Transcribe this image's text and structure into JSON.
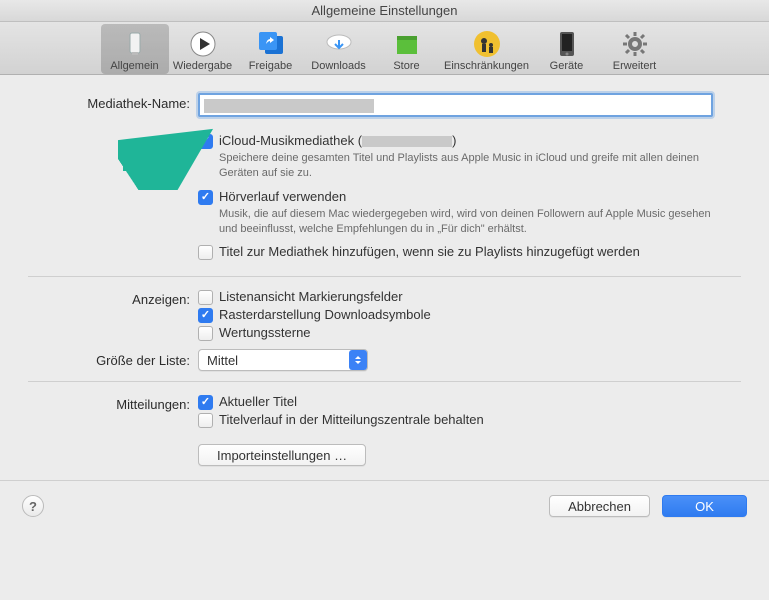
{
  "window": {
    "title": "Allgemeine Einstellungen"
  },
  "toolbar": {
    "items": [
      {
        "label": "Allgemein"
      },
      {
        "label": "Wiedergabe"
      },
      {
        "label": "Freigabe"
      },
      {
        "label": "Downloads"
      },
      {
        "label": "Store"
      },
      {
        "label": "Einschränkungen"
      },
      {
        "label": "Geräte"
      },
      {
        "label": "Erweitert"
      }
    ]
  },
  "labels": {
    "libraryName": "Mediathek-Name:",
    "show": "Anzeigen:",
    "listSize": "Größe der Liste:",
    "notifications": "Mitteilungen:"
  },
  "icloud": {
    "labelPrefix": "iCloud-Musikmediathek (",
    "labelSuffix": ")",
    "desc": "Speichere deine gesamten Titel und Playlists aus Apple Music in iCloud und greife mit allen deinen Geräten auf sie zu."
  },
  "history": {
    "label": "Hörverlauf verwenden",
    "desc": "Musik, die auf diesem Mac wiedergegeben wird, wird von deinen Followern auf Apple Music gesehen und beeinflusst, welche Empfehlungen du in „Für dich\" erhältst."
  },
  "addToLibrary": {
    "label": "Titel zur Mediathek hinzufügen, wenn sie zu Playlists hinzugefügt werden"
  },
  "show": {
    "listCheckboxes": "Listenansicht Markierungsfelder",
    "gridDownload": "Rasterdarstellung Downloadsymbole",
    "ratings": "Wertungssterne"
  },
  "listSize": {
    "value": "Mittel"
  },
  "notifications": {
    "current": "Aktueller Titel",
    "keepHistory": "Titelverlauf in der Mitteilungszentrale behalten"
  },
  "buttons": {
    "import": "Importeinstellungen …",
    "cancel": "Abbrechen",
    "ok": "OK",
    "help": "?"
  }
}
